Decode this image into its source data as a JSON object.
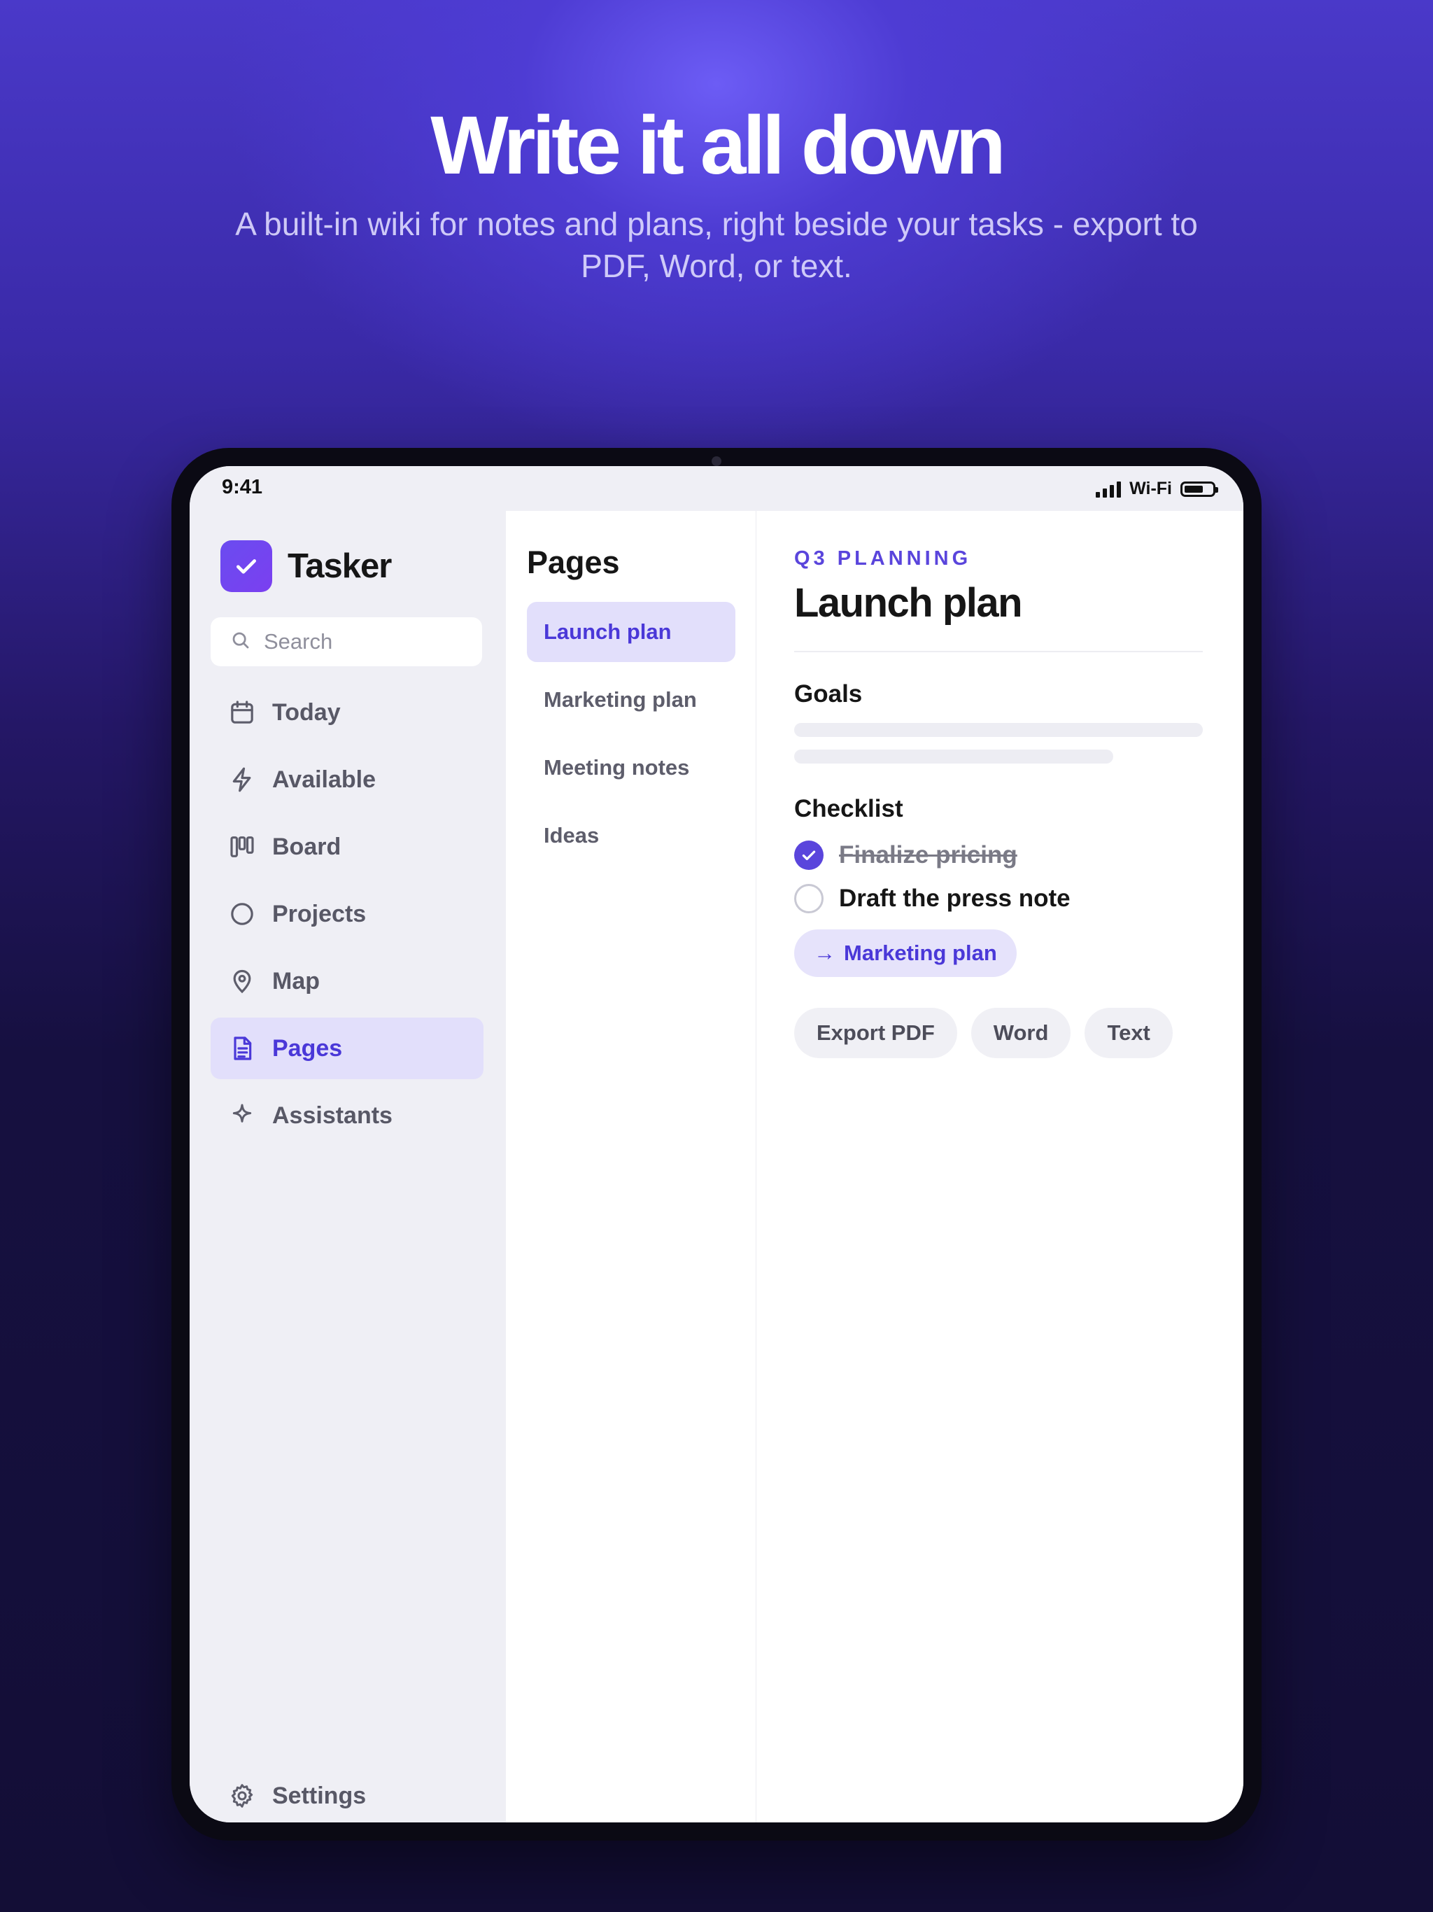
{
  "hero": {
    "title": "Write it all down",
    "subtitle": "A built-in wiki for notes and plans, right beside your tasks - export to PDF, Word, or text."
  },
  "status_bar": {
    "time": "9:41",
    "network": "Wi-Fi"
  },
  "app": {
    "name": "Tasker",
    "accent": "#5a45dc",
    "search": {
      "placeholder": "Search",
      "value": ""
    }
  },
  "sidebar": {
    "items": [
      {
        "label": "Today",
        "icon": "calendar-icon"
      },
      {
        "label": "Available",
        "icon": "lightning-icon"
      },
      {
        "label": "Board",
        "icon": "board-icon"
      },
      {
        "label": "Projects",
        "icon": "circle-icon"
      },
      {
        "label": "Map",
        "icon": "map-pin-icon"
      },
      {
        "label": "Pages",
        "icon": "document-icon",
        "active": true
      },
      {
        "label": "Assistants",
        "icon": "sparkle-icon"
      }
    ],
    "settings": {
      "label": "Settings",
      "icon": "gear-icon"
    }
  },
  "pages": {
    "title": "Pages",
    "items": [
      {
        "label": "Launch plan",
        "active": true
      },
      {
        "label": "Marketing plan"
      },
      {
        "label": "Meeting notes"
      },
      {
        "label": "Ideas"
      }
    ]
  },
  "document": {
    "eyebrow": "Q3 PLANNING",
    "title": "Launch plan",
    "goals_heading": "Goals",
    "checklist_heading": "Checklist",
    "checklist": [
      {
        "text": "Finalize pricing",
        "done": true
      },
      {
        "text": "Draft the press note",
        "done": false
      }
    ],
    "link": {
      "arrow": "→",
      "label": "Marketing plan"
    },
    "exports": [
      "Export PDF",
      "Word",
      "Text"
    ]
  }
}
